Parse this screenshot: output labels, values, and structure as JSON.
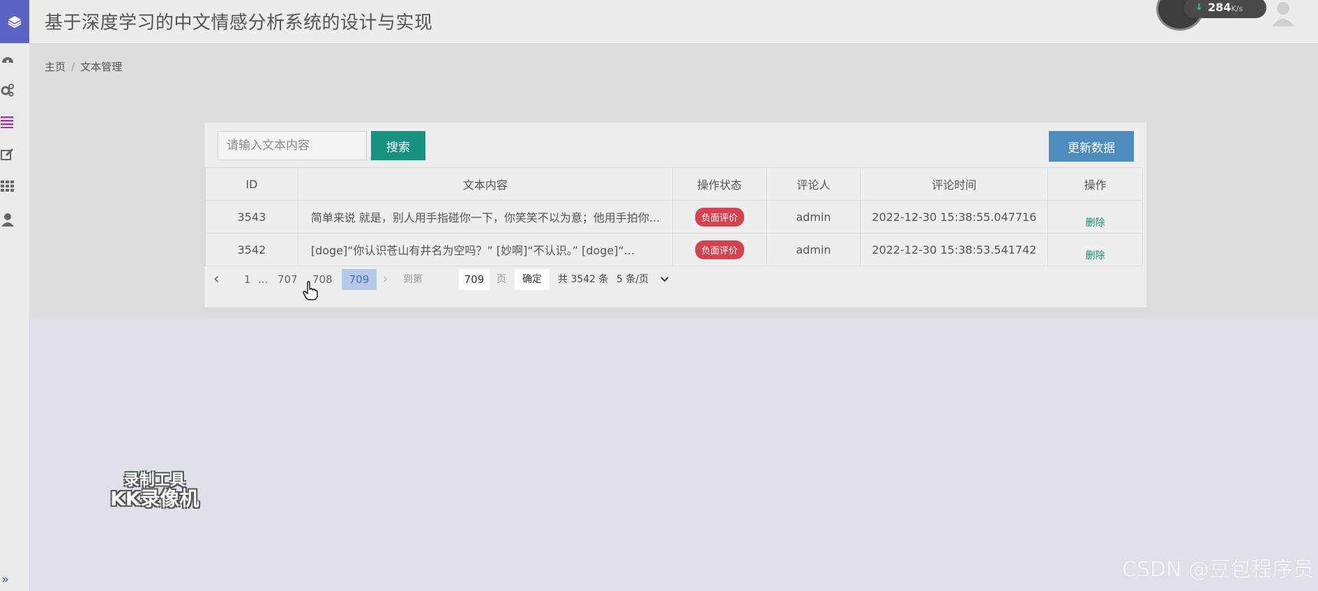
{
  "header": {
    "title": "基于深度学习的中文情感分析系统的设计与实现",
    "speed_value": "284",
    "speed_unit": "K/s"
  },
  "sidebar": {
    "expand_label": "»",
    "icons": [
      "layers-icon",
      "dashboard-icon",
      "settings-icon",
      "list-icon",
      "edit-icon",
      "grid-icon",
      "user-icon"
    ]
  },
  "breadcrumb": {
    "home": "主页",
    "separator": "/",
    "current": "文本管理"
  },
  "search": {
    "placeholder": "请输入文本内容",
    "button_label": "搜索"
  },
  "update_button_label": "更新数据",
  "table": {
    "headers": [
      "ID",
      "文本内容",
      "操作状态",
      "评论人",
      "评论时间",
      "操作"
    ],
    "rows": [
      {
        "id": "3543",
        "text": "简单来说 就是，别人用手指碰你一下，你笑笑不以为意；他用手拍你...",
        "status": "负面评价",
        "commenter": "admin",
        "time": "2022-12-30 15:38:55.047716",
        "action": "删除"
      },
      {
        "id": "3542",
        "text": "[doge]“你认识苍山有井名为空吗？” [妙啊]“不认识。” [doge]“...",
        "status": "负面评价",
        "commenter": "admin",
        "time": "2022-12-30 15:38:53.541742",
        "action": "删除"
      }
    ]
  },
  "pagination": {
    "prev": "‹",
    "first": "1",
    "ellipsis": "...",
    "pages": [
      "707",
      "708"
    ],
    "current": "709",
    "next": "›",
    "goto_prefix": "到第",
    "goto_value": "709",
    "goto_suffix": "页",
    "confirm": "确定",
    "total": "共 3542 条",
    "page_size": "5 条/页"
  },
  "watermarks": {
    "recorder_line1": "录制工具",
    "recorder_line2": "KK录像机",
    "csdn": "CSDN @豆包程序员"
  },
  "colors": {
    "brand_sidebar": "#5b64c2",
    "search_button": "#15917f",
    "update_button": "#4c8cbc",
    "negative_badge": "#d2434f",
    "delete_link": "#1d8c72"
  }
}
